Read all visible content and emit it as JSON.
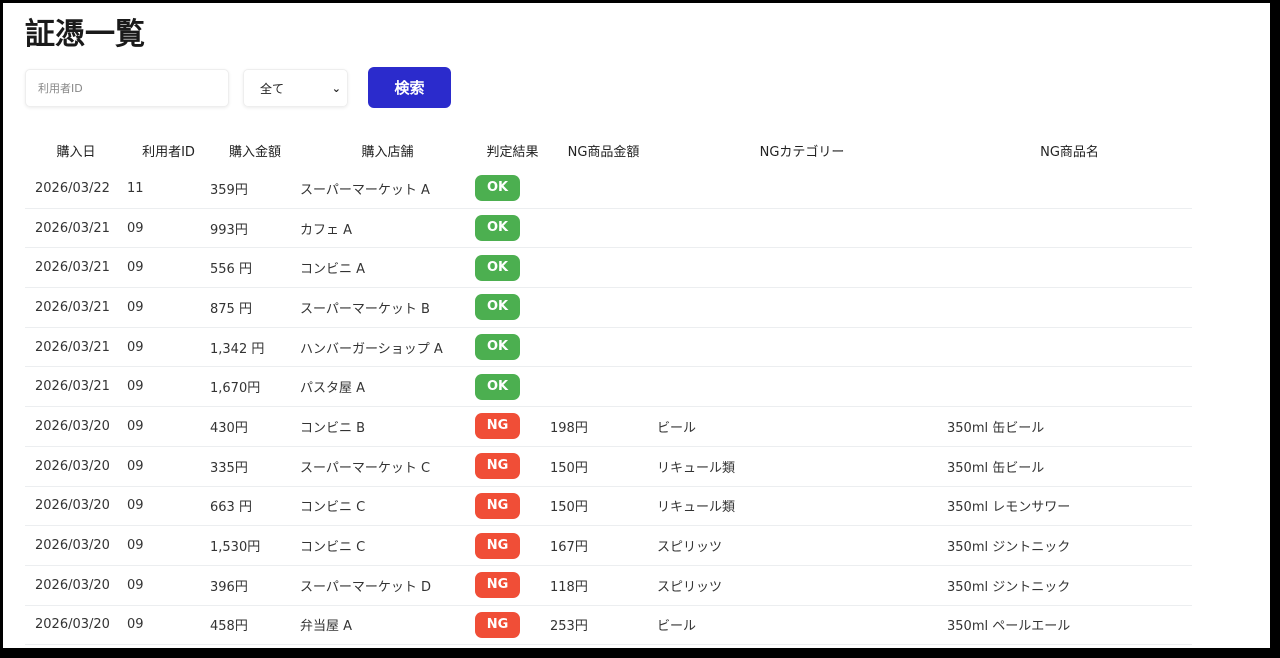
{
  "title": "証憑一覧",
  "filters": {
    "user_id_placeholder": "利用者ID",
    "user_id_value": "",
    "result_select": "全て",
    "search_label": "検索"
  },
  "colors": {
    "ok": "#4caf50",
    "ng": "#f04e37",
    "primary": "#2b2bcc"
  },
  "columns": [
    "購入日",
    "利用者ID",
    "購入金額",
    "購入店舗",
    "判定結果",
    "NG商品金額",
    "NGカテゴリー",
    "NG商品名"
  ],
  "rows": [
    {
      "date": "2026/03/22",
      "user": "11",
      "amount": "359円",
      "store": "スーパーマーケット A",
      "result": "OK",
      "ng_amount": "",
      "ng_category": "",
      "ng_item": ""
    },
    {
      "date": "2026/03/21",
      "user": "09",
      "amount": "993円",
      "store": "カフェ A",
      "result": "OK",
      "ng_amount": "",
      "ng_category": "",
      "ng_item": ""
    },
    {
      "date": "2026/03/21",
      "user": "09",
      "amount": "556 円",
      "store": "コンビニ A",
      "result": "OK",
      "ng_amount": "",
      "ng_category": "",
      "ng_item": ""
    },
    {
      "date": "2026/03/21",
      "user": "09",
      "amount": "875 円",
      "store": "スーパーマーケット B",
      "result": "OK",
      "ng_amount": "",
      "ng_category": "",
      "ng_item": ""
    },
    {
      "date": "2026/03/21",
      "user": "09",
      "amount": "1,342 円",
      "store": "ハンバーガーショップ A",
      "result": "OK",
      "ng_amount": "",
      "ng_category": "",
      "ng_item": ""
    },
    {
      "date": "2026/03/21",
      "user": "09",
      "amount": "1,670円",
      "store": "パスタ屋 A",
      "result": "OK",
      "ng_amount": "",
      "ng_category": "",
      "ng_item": ""
    },
    {
      "date": "2026/03/20",
      "user": "09",
      "amount": "430円",
      "store": "コンビニ B",
      "result": "NG",
      "ng_amount": "198円",
      "ng_category": "ビール",
      "ng_item": "350ml 缶ビール"
    },
    {
      "date": "2026/03/20",
      "user": "09",
      "amount": "335円",
      "store": "スーパーマーケット C",
      "result": "NG",
      "ng_amount": "150円",
      "ng_category": "リキュール類",
      "ng_item": "350ml 缶ビール"
    },
    {
      "date": "2026/03/20",
      "user": "09",
      "amount": "663 円",
      "store": "コンビニ C",
      "result": "NG",
      "ng_amount": "150円",
      "ng_category": "リキュール類",
      "ng_item": "350ml レモンサワー"
    },
    {
      "date": "2026/03/20",
      "user": "09",
      "amount": "1,530円",
      "store": "コンビニ C",
      "result": "NG",
      "ng_amount": "167円",
      "ng_category": "スピリッツ",
      "ng_item": "350ml ジントニック"
    },
    {
      "date": "2026/03/20",
      "user": "09",
      "amount": "396円",
      "store": "スーパーマーケット D",
      "result": "NG",
      "ng_amount": "118円",
      "ng_category": "スピリッツ",
      "ng_item": "350ml ジントニック"
    },
    {
      "date": "2026/03/20",
      "user": "09",
      "amount": "458円",
      "store": "弁当屋 A",
      "result": "NG",
      "ng_amount": "253円",
      "ng_category": "ビール",
      "ng_item": "350ml ペールエール"
    }
  ]
}
